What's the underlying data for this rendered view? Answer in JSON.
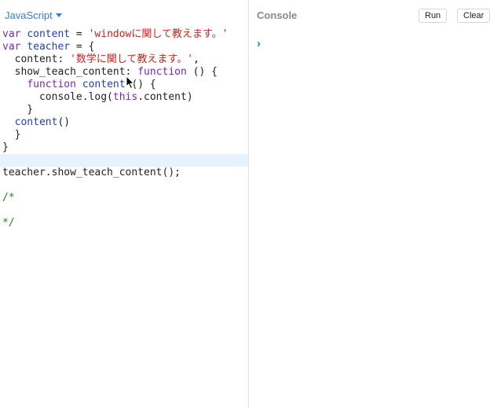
{
  "editor": {
    "language": "JavaScript",
    "lines": [
      [
        "var",
        " ",
        "content",
        " = ",
        "'windowに関して教えます。'"
      ],
      [
        "var",
        " ",
        "teacher",
        " = {"
      ],
      [
        "  content: ",
        "'数学に関して教えます。'",
        ","
      ],
      [
        "  show_teach_content: ",
        "function",
        " () {"
      ],
      [
        "    ",
        "function",
        " ",
        "content",
        " () {"
      ],
      [
        "      console.log(",
        "this",
        ".content)"
      ],
      [
        "    }"
      ],
      [
        "  ",
        "content",
        "()"
      ],
      [
        "  }"
      ],
      [
        "}"
      ],
      [
        ""
      ],
      [
        "teacher.show_teach_content();"
      ],
      [
        ""
      ],
      [
        "/*"
      ],
      [
        ""
      ],
      [
        "*/"
      ]
    ]
  },
  "console": {
    "title": "Console",
    "run_label": "Run",
    "clear_label": "Clear",
    "prompt_symbol": "›"
  }
}
